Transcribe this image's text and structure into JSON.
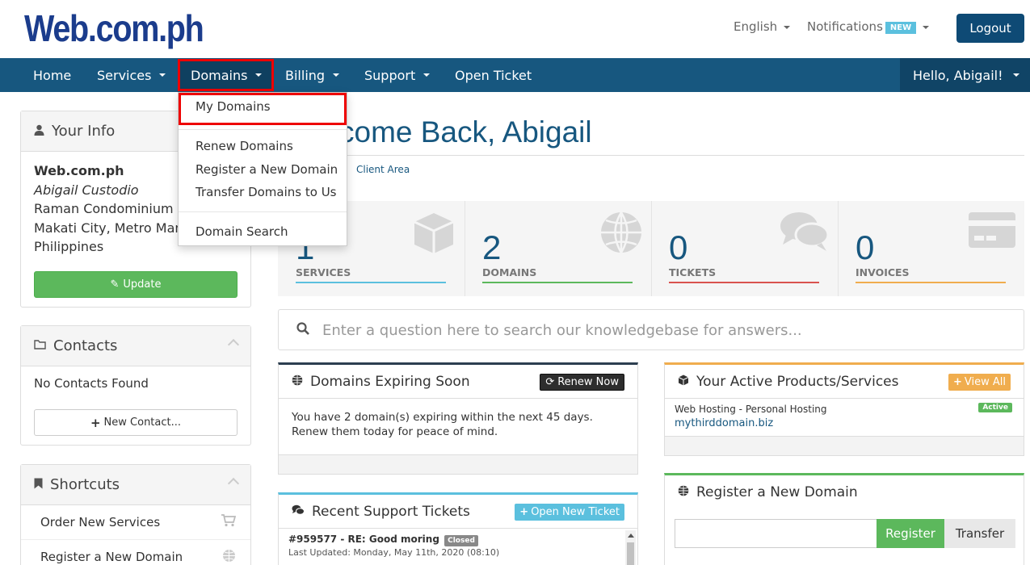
{
  "header": {
    "logo": "Web.com.ph",
    "language": "English",
    "notifications": "Notifications",
    "notifications_badge": "NEW",
    "logout": "Logout"
  },
  "nav": {
    "home": "Home",
    "services": "Services",
    "domains": "Domains",
    "billing": "Billing",
    "support": "Support",
    "open_ticket": "Open Ticket",
    "hello": "Hello, Abigail!"
  },
  "domains_menu": {
    "items": [
      "My Domains",
      "Renew Domains",
      "Register a New Domain",
      "Transfer Domains to Us",
      "Domain Search"
    ]
  },
  "sidebar": {
    "your_info": {
      "title": "Your Info",
      "company": "Web.com.ph",
      "name": "Abigail Custodio",
      "address1": "Raman Condominium",
      "address2": "Makati City, Metro Man",
      "country": "Philippines",
      "update_button": "Update"
    },
    "contacts": {
      "title": "Contacts",
      "empty": "No Contacts Found",
      "new_button": "New Contact..."
    },
    "shortcuts": {
      "title": "Shortcuts",
      "items": [
        "Order New Services",
        "Register a New Domain"
      ]
    }
  },
  "main": {
    "welcome": "come Back, Abigail",
    "breadcrumb": "Client Area",
    "tiles": [
      {
        "value": "1",
        "label": "SERVICES",
        "color": "#5bc0de"
      },
      {
        "value": "2",
        "label": "DOMAINS",
        "color": "#5cb85c"
      },
      {
        "value": "0",
        "label": "TICKETS",
        "color": "#d9534f"
      },
      {
        "value": "0",
        "label": "INVOICES",
        "color": "#f0ad4e"
      }
    ],
    "kb_search_placeholder": "Enter a question here to search our knowledgebase for answers...",
    "domains_expiring": {
      "title": "Domains Expiring Soon",
      "button": "Renew Now",
      "text": "You have 2 domain(s) expiring within the next 45 days. Renew them today for peace of mind."
    },
    "active_products": {
      "title": "Your Active Products/Services",
      "button": "View All",
      "product": "Web Hosting - Personal Hosting",
      "domain": "mythirddomain.biz",
      "status": "Active"
    },
    "recent_tickets": {
      "title": "Recent Support Tickets",
      "button": "Open New Ticket",
      "ticket_title": "#959577 - RE: Good moring",
      "ticket_status": "Closed",
      "ticket_updated": "Last Updated: Monday, May 11th, 2020 (08:10)"
    },
    "register_domain": {
      "title": "Register a New Domain",
      "register_button": "Register",
      "transfer_button": "Transfer"
    }
  },
  "colors": {
    "navbar": "#17577f",
    "logo": "#1b3c8c",
    "highlight_border": "#e00000"
  }
}
